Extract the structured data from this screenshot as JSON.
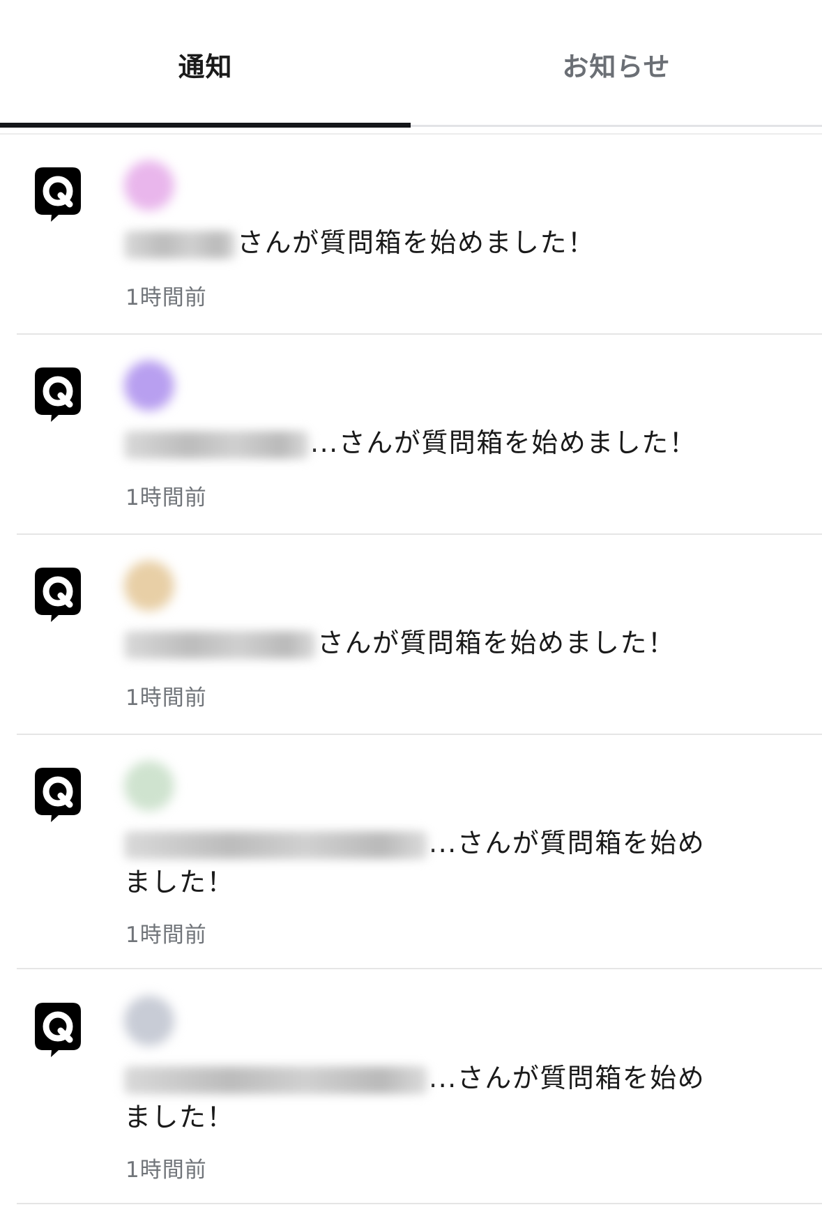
{
  "tabs": [
    {
      "label": "通知",
      "active": true
    },
    {
      "label": "お知らせ",
      "active": false
    }
  ],
  "notifications": [
    {
      "icon": "question-box-icon",
      "avatar_color": "#e9b6ec",
      "name_ellipsis": "",
      "message": "さんが質問箱を始めました！",
      "time": "1時間前"
    },
    {
      "icon": "question-box-icon",
      "avatar_color": "#b89ff0",
      "name_ellipsis": "...",
      "message": "さんが質問箱を始めました！",
      "time": "1時間前"
    },
    {
      "icon": "question-box-icon",
      "avatar_color": "#e8cfa6",
      "name_ellipsis": "",
      "message": "さんが質問箱を始めました！",
      "time": "1時間前"
    },
    {
      "icon": "question-box-icon",
      "avatar_color": "#cfe3cf",
      "name_ellipsis": "...",
      "message": "さんが質問箱を始めました！",
      "time": "1時間前"
    },
    {
      "icon": "question-box-icon",
      "avatar_color": "#c8ccd6",
      "name_ellipsis": "...",
      "message": "さんが質問箱を始めました！",
      "time": "1時間前"
    }
  ],
  "colors": {
    "active_tab_text": "#1a1a1a",
    "inactive_tab_text": "#6b6f75",
    "active_underline": "#15171a",
    "time_text": "#707479",
    "divider": "#e5e5e5"
  }
}
